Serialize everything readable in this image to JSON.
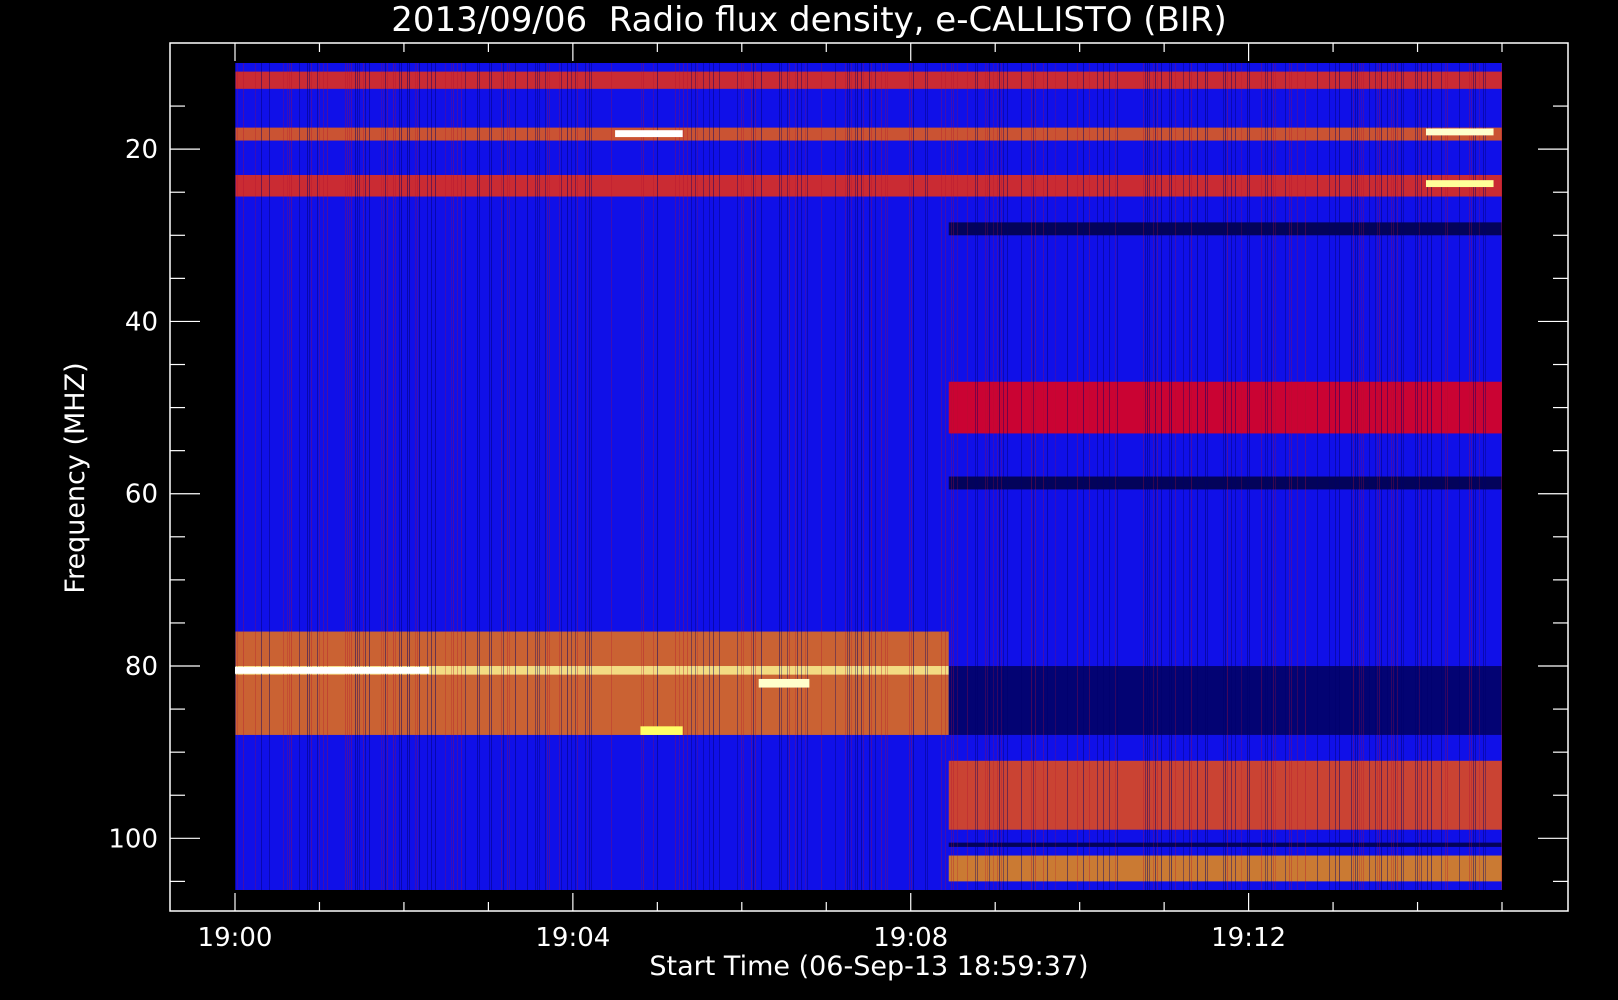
{
  "chart_data": {
    "type": "heatmap",
    "title": "2013/09/06  Radio flux density, e-CALLISTO (BIR)",
    "xlabel": "Start Time (06-Sep-13 18:59:37)",
    "ylabel": "Frequency (MHZ)",
    "x_ticks": [
      "19:00",
      "19:04",
      "19:08",
      "19:12"
    ],
    "y_ticks": [
      "20",
      "40",
      "60",
      "80",
      "100"
    ],
    "x_range_minutes": [
      0,
      15
    ],
    "y_range_mhz": [
      10,
      106
    ],
    "colormap": [
      "#000000",
      "#0000ff",
      "#ff0000",
      "#ffff00",
      "#ffffff"
    ],
    "colors": {
      "background": "#000000",
      "axes": "#ffffff",
      "base": "#1010e8"
    },
    "bands_mhz": [
      {
        "start_min": 0,
        "end_min": 15,
        "f_low": 11,
        "f_high": 13,
        "intensity": 0.55
      },
      {
        "start_min": 0,
        "end_min": 15,
        "f_low": 17.5,
        "f_high": 19,
        "intensity": 0.6
      },
      {
        "start_min": 0,
        "end_min": 15,
        "f_low": 23,
        "f_high": 25.5,
        "intensity": 0.55
      },
      {
        "start_min": 0,
        "end_min": 8.45,
        "f_low": 76,
        "f_high": 88,
        "intensity": 0.62
      },
      {
        "start_min": 0,
        "end_min": 8.45,
        "f_low": 80,
        "f_high": 81,
        "intensity": 0.9
      },
      {
        "start_min": 8.45,
        "end_min": 15,
        "f_low": 28.5,
        "f_high": 30,
        "intensity": 0.05
      },
      {
        "start_min": 8.45,
        "end_min": 15,
        "f_low": 47,
        "f_high": 53,
        "intensity": 0.5
      },
      {
        "start_min": 8.45,
        "end_min": 15,
        "f_low": 58,
        "f_high": 59.5,
        "intensity": 0.05
      },
      {
        "start_min": 8.45,
        "end_min": 15,
        "f_low": 80,
        "f_high": 88,
        "intensity": 0.08
      },
      {
        "start_min": 8.45,
        "end_min": 15,
        "f_low": 91,
        "f_high": 99,
        "intensity": 0.58
      },
      {
        "start_min": 8.45,
        "end_min": 15,
        "f_low": 100.5,
        "f_high": 101,
        "intensity": 0.05
      },
      {
        "start_min": 8.45,
        "end_min": 15,
        "f_low": 102,
        "f_high": 105,
        "intensity": 0.65
      }
    ],
    "bursts": [
      {
        "start_min": 4.5,
        "end_min": 5.3,
        "f_low": 17.8,
        "f_high": 18.6,
        "intensity": 1.0
      },
      {
        "start_min": 0,
        "end_min": 2.3,
        "f_low": 80.1,
        "f_high": 80.9,
        "intensity": 1.0
      },
      {
        "start_min": 6.2,
        "end_min": 6.8,
        "f_low": 81.5,
        "f_high": 82.5,
        "intensity": 0.95
      },
      {
        "start_min": 4.8,
        "end_min": 5.3,
        "f_low": 87,
        "f_high": 88,
        "intensity": 0.85
      },
      {
        "start_min": 14.1,
        "end_min": 14.9,
        "f_low": 17.6,
        "f_high": 18.4,
        "intensity": 0.95
      },
      {
        "start_min": 14.1,
        "end_min": 14.9,
        "f_low": 23.6,
        "f_high": 24.4,
        "intensity": 0.9
      }
    ]
  }
}
